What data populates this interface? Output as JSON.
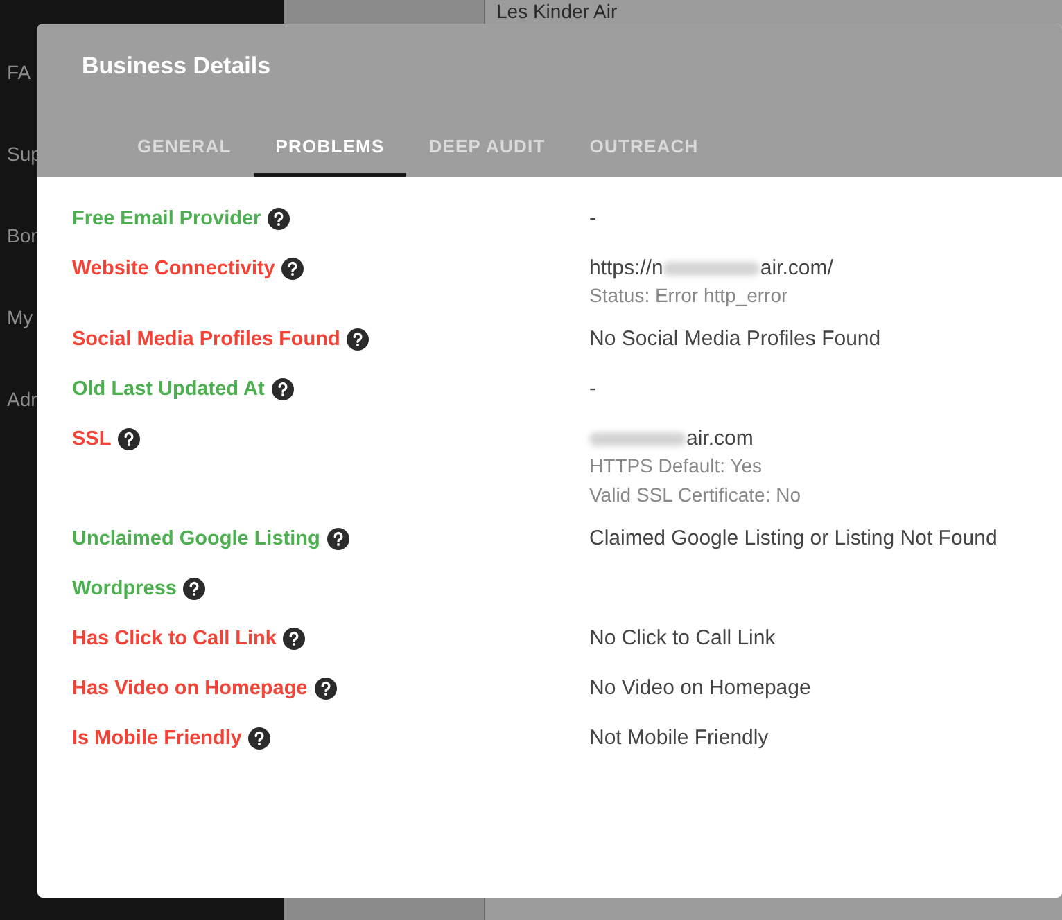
{
  "sidebar": {
    "items": [
      {
        "label": "FA"
      },
      {
        "label": "Sup"
      },
      {
        "label": "Bon"
      },
      {
        "label": "My"
      },
      {
        "label": "Adr"
      }
    ]
  },
  "background_list": {
    "title": "Les Kinder Air"
  },
  "dialog": {
    "title": "Business Details",
    "tabs": [
      {
        "label": "GENERAL",
        "selected": false
      },
      {
        "label": "PROBLEMS",
        "selected": true
      },
      {
        "label": "DEEP AUDIT",
        "selected": false
      },
      {
        "label": "OUTREACH",
        "selected": false
      }
    ],
    "rows": [
      {
        "label": "Free Email Provider",
        "problem": false,
        "lines": [
          {
            "kind": "main",
            "text": "-"
          }
        ]
      },
      {
        "label": "Website Connectivity",
        "problem": true,
        "lines": [
          {
            "kind": "redacted",
            "before": "https://n",
            "after": "air.com/"
          },
          {
            "kind": "sub",
            "text": "Status: Error http_error"
          }
        ]
      },
      {
        "label": "Social Media Profiles Found",
        "problem": true,
        "lines": [
          {
            "kind": "main",
            "text": "No Social Media Profiles Found"
          }
        ]
      },
      {
        "label": "Old Last Updated At",
        "problem": false,
        "lines": [
          {
            "kind": "main",
            "text": "-"
          }
        ]
      },
      {
        "label": "SSL",
        "problem": true,
        "lines": [
          {
            "kind": "redacted",
            "after": "air.com"
          },
          {
            "kind": "sub",
            "text": "HTTPS Default: Yes"
          },
          {
            "kind": "sub",
            "text": "Valid SSL Certificate: No"
          }
        ]
      },
      {
        "label": "Unclaimed Google Listing",
        "problem": false,
        "lines": [
          {
            "kind": "main",
            "text": "Claimed Google Listing or Listing Not Found"
          }
        ]
      },
      {
        "label": "Wordpress",
        "problem": false,
        "lines": []
      },
      {
        "label": "Has Click to Call Link",
        "problem": true,
        "lines": [
          {
            "kind": "main",
            "text": "No Click to Call Link"
          }
        ]
      },
      {
        "label": "Has Video on Homepage",
        "problem": true,
        "lines": [
          {
            "kind": "main",
            "text": "No Video on Homepage"
          }
        ]
      },
      {
        "label": "Is Mobile Friendly",
        "problem": true,
        "lines": [
          {
            "kind": "main",
            "text": "Not Mobile Friendly"
          }
        ]
      }
    ]
  }
}
